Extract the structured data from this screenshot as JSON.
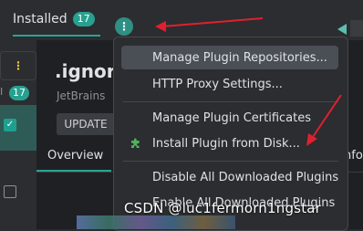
{
  "header": {
    "tab_installed_label": "Installed",
    "installed_count": "17"
  },
  "sidebar": {
    "count": "17",
    "truncated_i": "I"
  },
  "plugin": {
    "name": ".ignore",
    "vendor": "JetBrains",
    "update_label": "UPDATE",
    "tabs": {
      "overview": "Overview",
      "info_partial": "nfo"
    }
  },
  "menu": {
    "items": [
      {
        "label": "Manage Plugin Repositories..."
      },
      {
        "label": "HTTP Proxy Settings..."
      },
      {
        "label": "Manage Plugin Certificates"
      },
      {
        "label": "Install Plugin from Disk..."
      },
      {
        "label": "Disable All Downloaded Plugins"
      },
      {
        "label": "Enable All Downloaded Plugins"
      }
    ]
  },
  "watermark": "CSDN @luc1fermorn1ngstar",
  "colors": {
    "accent_teal": "#29a495",
    "annotation_red": "#e0202e",
    "menu_highlight": "#4a4f56"
  }
}
